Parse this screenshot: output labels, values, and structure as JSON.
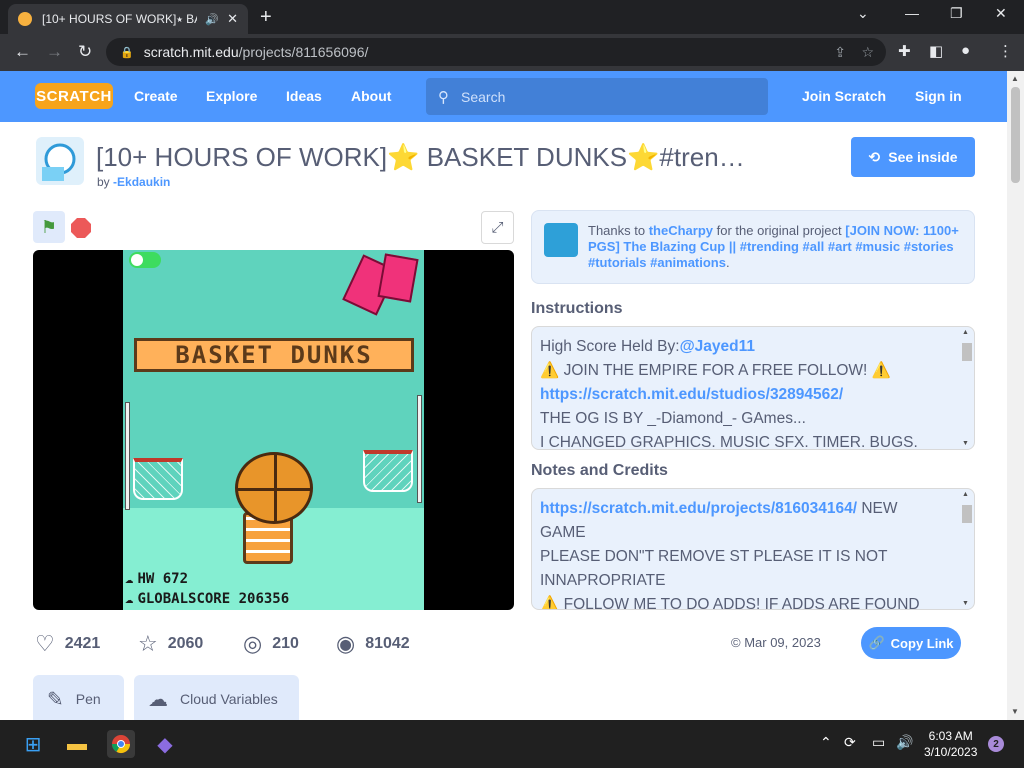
{
  "browser": {
    "tab_title": "[10+ HOURS OF WORK]⭑ BA",
    "url_host": "scratch.mit.edu",
    "url_path": "/projects/811656096/"
  },
  "scratch_nav": {
    "logo": "SCRATCH",
    "links": [
      "Create",
      "Explore",
      "Ideas",
      "About"
    ],
    "search_placeholder": "Search",
    "join": "Join Scratch",
    "signin": "Sign in"
  },
  "project": {
    "title": "[10+ HOURS OF WORK]⭐ BASKET DUNKS⭐#tren…",
    "by_prefix": "by",
    "author": "-Ekdaukin",
    "see_inside": "See inside"
  },
  "game": {
    "banner": "BASKET DUNKS",
    "hw": "HW 672",
    "global": "GLOBALSCORE 206356"
  },
  "remix": {
    "prefix": "Thanks to",
    "user": "theCharpy",
    "mid": "for the original project",
    "project": "[JOIN NOW: 1100+ PGS] The Blazing Cup || #trending #all #art #music #stories #tutorials #animations",
    "end": "."
  },
  "instructions": {
    "heading": "Instructions",
    "line1_prefix": "High Score Held By:",
    "line1_user": "@Jayed11",
    "line2": "⚠️ JOIN THE EMPIRE FOR A FREE FOLLOW! ⚠️",
    "line3": "https://scratch.mit.edu/studios/32894562/",
    "line4": "THE OG IS BY _-Diamond_- GAmes...",
    "line5": "I CHANGED GRAPHICS. MUSIC SFX. TIMER. BUGS."
  },
  "notes": {
    "heading": "Notes and Credits",
    "line1_link": "https://scratch.mit.edu/projects/816034164/",
    "line1_rest": "NEW",
    "line2": "GAME",
    "line3": "PLEASE DON\"T REMOVE ST PLEASE IT IS NOT",
    "line4": "INNAPROPRIATE",
    "line5": "⚠️  FOLLOW ME TO DO ADDS! IF ADDS ARE FOUND"
  },
  "stats": {
    "loves": "2421",
    "favorites": "2060",
    "remixes": "210",
    "views": "81042",
    "date": "© Mar 09, 2023",
    "copy_link": "Copy Link"
  },
  "tags": [
    "Pen",
    "Cloud Variables"
  ],
  "taskbar": {
    "time": "6:03 AM",
    "date": "3/10/2023",
    "notifications": "2"
  },
  "colors": {
    "scratch_blue": "#4d97ff",
    "scratch_orange": "#f7a41b",
    "text": "#575e75"
  }
}
